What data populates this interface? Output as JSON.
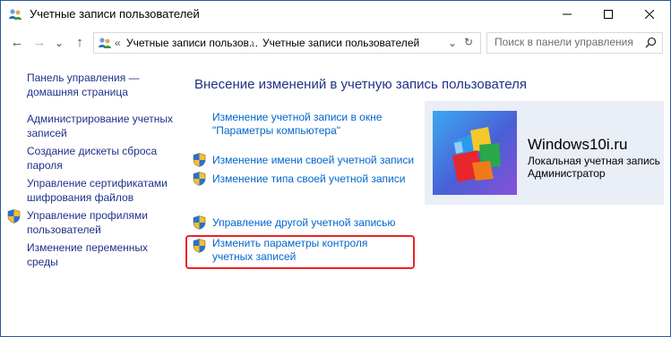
{
  "window": {
    "title": "Учетные записи пользователей"
  },
  "address": {
    "overflow": "«",
    "crumb1": "Учетные записи пользов...",
    "separator": "›",
    "crumb2": "Учетные записи пользователей",
    "dropdown_glyph": "⌄",
    "refresh_glyph": "↻"
  },
  "nav": {
    "back": "←",
    "forward": "→",
    "recent": "⌄",
    "up": "↑"
  },
  "search": {
    "placeholder": "Поиск в панели управления"
  },
  "sidebar": {
    "items": [
      {
        "label": "Панель управления — домашняя страница"
      },
      {
        "label": "Администрирование учетных записей"
      },
      {
        "label": "Создание дискеты сброса пароля"
      },
      {
        "label": "Управление сертификатами шифрования файлов"
      },
      {
        "label": "Управление профилями пользователей"
      },
      {
        "label": "Изменение переменных среды"
      }
    ]
  },
  "main": {
    "heading": "Внесение изменений в учетную запись пользователя",
    "links": [
      {
        "label": "Изменение учетной записи в окне \"Параметры компьютера\""
      },
      {
        "label": "Изменение имени своей учетной записи"
      },
      {
        "label": "Изменение типа своей учетной записи"
      },
      {
        "label": "Управление другой учетной записью"
      },
      {
        "label": "Изменить параметры контроля учетных записей"
      }
    ]
  },
  "user": {
    "name": "Windows10i.ru",
    "account_type": "Локальная учетная запись",
    "role": "Администратор"
  },
  "colors": {
    "link": "#0066cc",
    "sidebar_link": "#1e3287",
    "highlight": "#e22222",
    "user_panel": "#e9eef7"
  }
}
